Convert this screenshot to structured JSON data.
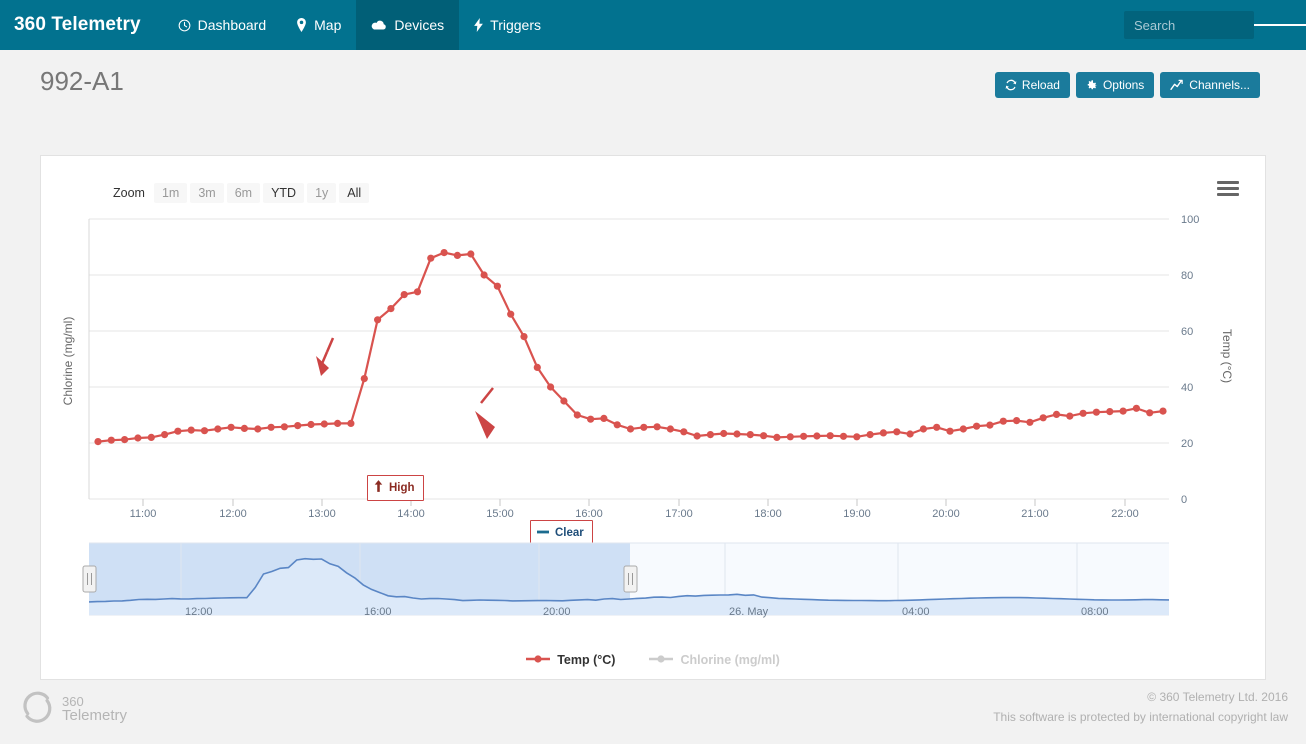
{
  "navbar": {
    "brand": "360 Telemetry",
    "items": [
      {
        "label": "Dashboard",
        "icon": "clock-icon",
        "active": false
      },
      {
        "label": "Map",
        "icon": "map-pin-icon",
        "active": false
      },
      {
        "label": "Devices",
        "icon": "cloud-icon",
        "active": true
      },
      {
        "label": "Triggers",
        "icon": "bolt-icon",
        "active": false
      }
    ],
    "search_placeholder": "Search",
    "search_value": "",
    "menu_icon": "hamburger-icon",
    "bg_color": "#02728f",
    "active_bg_color": "#015f77"
  },
  "page": {
    "title": "992-A1",
    "buttons": [
      {
        "label": "Reload",
        "icon": "refresh-icon"
      },
      {
        "label": "Options",
        "icon": "gear-icon"
      },
      {
        "label": "Channels...",
        "icon": "chart-line-icon"
      }
    ],
    "button_color": "#1b7b9c"
  },
  "chart_panel": {
    "zoom_label": "Zoom",
    "zoom_buttons": [
      {
        "label": "1m",
        "enabled": false
      },
      {
        "label": "3m",
        "enabled": false
      },
      {
        "label": "6m",
        "enabled": false
      },
      {
        "label": "YTD",
        "enabled": true
      },
      {
        "label": "1y",
        "enabled": false
      },
      {
        "label": "All",
        "enabled": true
      }
    ],
    "export_menu_icon": "hamburger-icon",
    "flags": [
      {
        "label": "High",
        "icon": "arrow-up-icon",
        "color": "#8b2b22",
        "border": "#cc4444"
      },
      {
        "label": "Clear",
        "icon": "dash-icon",
        "color": "#1f4e79",
        "border": "#cc4444"
      }
    ],
    "legend": [
      {
        "label": "Temp (°C)",
        "active": true,
        "color": "#d9534f"
      },
      {
        "label": "Chlorine (mg/ml)",
        "active": false,
        "color": "#cccccc"
      }
    ],
    "navigator": {
      "tick_labels": [
        "12:00",
        "16:00",
        "20:00",
        "26. May",
        "04:00",
        "08:00"
      ],
      "selection_start_label": "12:00",
      "selection_end_label": "26. May",
      "series_color": "#5a86c5",
      "selection_fill": "#cfe0f5"
    }
  },
  "chart_data": {
    "type": "line",
    "title": "",
    "xlabel": "",
    "ylabel": "Chlorine (mg/ml)",
    "y2label": "Temp (°C)",
    "grid": true,
    "legend_position": "bottom",
    "ylim": [
      0,
      100
    ],
    "yticks": [
      0,
      20,
      40,
      60,
      80,
      100
    ],
    "xticks": [
      "11:00",
      "12:00",
      "13:00",
      "14:00",
      "15:00",
      "16:00",
      "17:00",
      "18:00",
      "19:00",
      "20:00",
      "21:00",
      "22:00"
    ],
    "xlim": [
      "10:40",
      "22:20"
    ],
    "series": [
      {
        "name": "Temp (°C)",
        "color": "#d9534f",
        "visible": true,
        "values": [
          20.5,
          21.0,
          21.2,
          21.8,
          22.0,
          23.0,
          24.2,
          24.6,
          24.4,
          25.0,
          25.6,
          25.2,
          25.0,
          25.6,
          25.8,
          26.2,
          26.6,
          26.8,
          27.0,
          27.0,
          43.0,
          64.0,
          68.0,
          73.0,
          74.0,
          86.0,
          88.0,
          87.0,
          87.5,
          80.0,
          76.0,
          66.0,
          58.0,
          47.0,
          40.0,
          35.0,
          30.0,
          28.5,
          28.8,
          26.5,
          25.0,
          25.6,
          25.8,
          25.0,
          24.0,
          22.5,
          23.0,
          23.4,
          23.2,
          23.0,
          22.6,
          22.0,
          22.2,
          22.4,
          22.5,
          22.6,
          22.4,
          22.2,
          23.0,
          23.6,
          24.0,
          23.2,
          25.0,
          25.6,
          24.2,
          25.0,
          26.0,
          26.4,
          27.8,
          28.0,
          27.4,
          29.0,
          30.2,
          29.6,
          30.6,
          31.0,
          31.2,
          31.4,
          32.4,
          30.8,
          31.4
        ]
      },
      {
        "name": "Chlorine (mg/ml)",
        "color": "#cccccc",
        "visible": false,
        "values": []
      }
    ],
    "annotations": [
      {
        "label": "High",
        "x": "13:10",
        "y": 55
      },
      {
        "label": "Clear",
        "x": "14:50",
        "y": 41
      }
    ]
  },
  "footer": {
    "logo_line1": "360",
    "logo_line2": "Telemetry",
    "copyright": "© 360 Telemetry Ltd. 2016",
    "notice": "This software is protected by international copyright law"
  }
}
